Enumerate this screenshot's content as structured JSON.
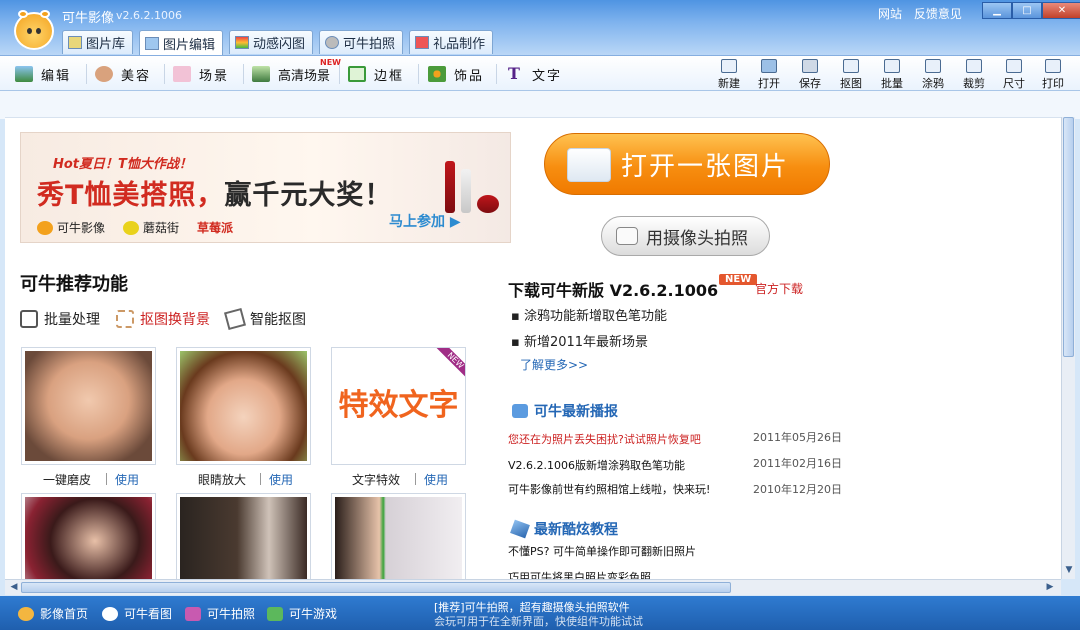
{
  "app": {
    "title": "可牛影像",
    "version": "v2.6.2.1006"
  },
  "top_links": [
    "网站",
    "反馈意见"
  ],
  "window_controls": {
    "minimize": "▁",
    "maximize": "□",
    "close": "✕"
  },
  "main_tabs": [
    {
      "label": "图片库",
      "icon": "library-icon"
    },
    {
      "label": "图片编辑",
      "icon": "image-edit-icon"
    },
    {
      "label": "动感闪图",
      "icon": "flash-icon"
    },
    {
      "label": "可牛拍照",
      "icon": "webcam-icon"
    },
    {
      "label": "礼品制作",
      "icon": "gift-icon"
    }
  ],
  "toolbar_left": [
    {
      "label": "编辑",
      "icon": "edit-icon"
    },
    {
      "label": "美容",
      "icon": "beauty-icon"
    },
    {
      "label": "场景",
      "icon": "scene-icon"
    },
    {
      "label": "高清场景",
      "icon": "hd-scene-icon",
      "badge": "NEW"
    },
    {
      "label": "边框",
      "icon": "frame-icon"
    },
    {
      "label": "饰品",
      "icon": "accessory-icon"
    },
    {
      "label": "文字",
      "icon": "text-icon"
    }
  ],
  "toolbar_right": [
    {
      "label": "新建",
      "icon": "new-icon"
    },
    {
      "label": "打开",
      "icon": "open-icon"
    },
    {
      "label": "保存",
      "icon": "save-icon"
    },
    {
      "label": "抠图",
      "icon": "cutout-icon"
    },
    {
      "label": "批量",
      "icon": "batch-icon"
    },
    {
      "label": "涂鸦",
      "icon": "doodle-icon"
    },
    {
      "label": "裁剪",
      "icon": "crop-icon"
    },
    {
      "label": "尺寸",
      "icon": "resize-icon"
    },
    {
      "label": "打印",
      "icon": "print-icon"
    }
  ],
  "promo": {
    "hot": "Hot夏日！T恤大作战！",
    "main_a": "秀T恤美搭照，",
    "main_b": "赢千元大奖！",
    "brands": [
      "可牛影像",
      "蘑菇街",
      "草莓派"
    ],
    "join": "马上参加 ▶"
  },
  "buttons": {
    "open_image": "打开一张图片",
    "camera": "用摄像头拍照"
  },
  "recommend": {
    "title": "可牛推荐功能",
    "links": [
      {
        "label": "批量处理",
        "icon": "tools-icon"
      },
      {
        "label": "抠图换背景",
        "icon": "scissors-icon"
      },
      {
        "label": "智能抠图",
        "icon": "smart-cutout-icon"
      }
    ],
    "features": [
      {
        "label": "一键磨皮",
        "use": "使用"
      },
      {
        "label": "眼睛放大",
        "use": "使用"
      },
      {
        "label": "文字特效",
        "use": "使用",
        "art": "特效文字",
        "badge": "NEW"
      }
    ]
  },
  "download": {
    "title": "下载可牛新版 V2.6.2.1006",
    "badge": "NEW",
    "official": "官方下载",
    "items": [
      "涂鸦功能新增取色笔功能",
      "新增2011年最新场景"
    ],
    "more": "了解更多>>"
  },
  "news": {
    "title": "可牛最新播报",
    "items": [
      {
        "text": "您还在为照片丢失困扰?试试照片恢复吧",
        "date": "2011年05月26日",
        "highlight": true
      },
      {
        "text": "V2.6.2.1006版新增涂鸦取色笔功能",
        "date": "2011年02月16日",
        "highlight": false
      },
      {
        "text": "可牛影像前世有约照相馆上线啦，快来玩!",
        "date": "2010年12月20日",
        "highlight": false
      }
    ]
  },
  "tutorials": {
    "title": "最新酷炫教程",
    "items": [
      "不懂PS? 可牛简单操作即可翻新旧照片",
      "巧用可牛将黑白照片变彩色照"
    ]
  },
  "statusbar": {
    "items": [
      {
        "label": "影像首页",
        "icon": "home-icon"
      },
      {
        "label": "可牛看图",
        "icon": "viewer-icon"
      },
      {
        "label": "可牛拍照",
        "icon": "camera-icon"
      },
      {
        "label": "可牛游戏",
        "icon": "game-icon"
      }
    ],
    "marquee": [
      "[推荐]可牛拍照，超有趣摄像头拍照软件",
      "会玩可用于在全新界面，快使组件功能试试"
    ]
  },
  "colors": {
    "accent": "#3c86d9",
    "orange": "#f78e10",
    "link": "#2467b5",
    "red": "#cc2222"
  }
}
